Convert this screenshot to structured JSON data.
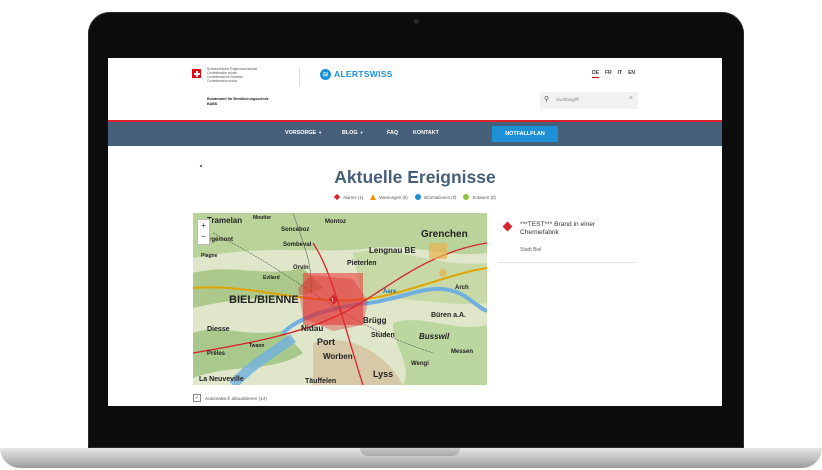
{
  "header": {
    "confederation_lines": [
      "Schweizerische Eidgenossenschaft",
      "Confédération suisse",
      "Confederazione Svizzera",
      "Confederaziun svizra"
    ],
    "office_lines": [
      "Bundesamt für Bevölkerungsschutz",
      "BABS"
    ],
    "logo_text": "ALERTSWISS",
    "languages": [
      "DE",
      "FR",
      "IT",
      "EN"
    ],
    "active_language": "DE",
    "search_placeholder": "Suchbegriff"
  },
  "nav": {
    "items": [
      {
        "label": "VORSORGE",
        "dropdown": true
      },
      {
        "label": "BLOG",
        "dropdown": true
      },
      {
        "label": "FAQ",
        "dropdown": false
      },
      {
        "label": "KONTAKT",
        "dropdown": false
      }
    ],
    "cta_label": "NOTFALLPLAN"
  },
  "page": {
    "title": "Aktuelle Ereignisse",
    "legend": [
      {
        "label": "Alarme (1)",
        "icon": "alarm-icon"
      },
      {
        "label": "Warnungen (0)",
        "icon": "warning-icon"
      },
      {
        "label": "Informationen (0)",
        "icon": "info-icon"
      },
      {
        "label": "Entwarnt (0)",
        "icon": "all-clear-icon"
      }
    ],
    "auto_refresh_label": "Automatisch aktualisieren (14)"
  },
  "map": {
    "zoom_in": "+",
    "zoom_out": "−",
    "labels": [
      "Tramelan",
      "Corgémont",
      "Sonceboz",
      "Sombeval",
      "Orvin",
      "Lengnau BE",
      "Grenchen",
      "Pieterlen",
      "BIEL/BIENNE",
      "Diesse",
      "Täuffelen",
      "Nidau",
      "Brügg",
      "Büren a.A.",
      "Lyss",
      "Port",
      "Worben",
      "La Neuveville",
      "Prêles",
      "Studen",
      "Arch",
      "Messen",
      "Wengi",
      "Busswil",
      "Moutier",
      "Plagne",
      "Aare",
      "Twann",
      "Evilard",
      "Montoz"
    ]
  },
  "event": {
    "title": "***TEST*** Brand in einer Chemiefabrik",
    "location": "Stadt Biel"
  },
  "colors": {
    "accent_blue": "#1e91d6",
    "nav_bg": "#47607a",
    "swiss_red": "#e30613",
    "alarm_red": "#d8232a",
    "warning_orange": "#f39200",
    "allclear_green": "#8dc63f"
  }
}
